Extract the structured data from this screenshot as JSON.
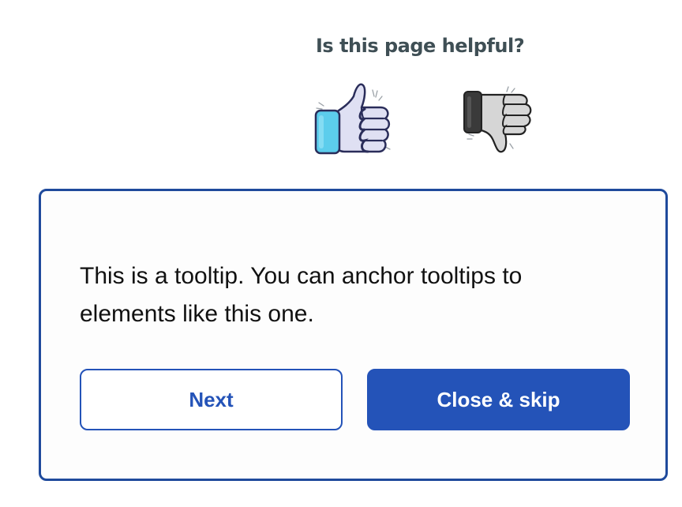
{
  "feedback": {
    "question": "Is this page helpful?",
    "thumbs_up_icon": "thumbs-up-icon",
    "thumbs_down_icon": "thumbs-down-icon"
  },
  "tooltip": {
    "text": "This is a tooltip. You can anchor tooltips to elements like this one.",
    "next_label": "Next",
    "close_label": "Close & skip"
  },
  "colors": {
    "primary": "#2453b8",
    "tooltip_border": "#1f4a9c",
    "question_text": "#3f4f55",
    "thumb_up_cuff": "#5ccdec",
    "thumb_up_hand": "#dfe0f3",
    "thumb_down_cuff": "#3a3a3a",
    "thumb_down_hand": "#d6d6d6"
  }
}
